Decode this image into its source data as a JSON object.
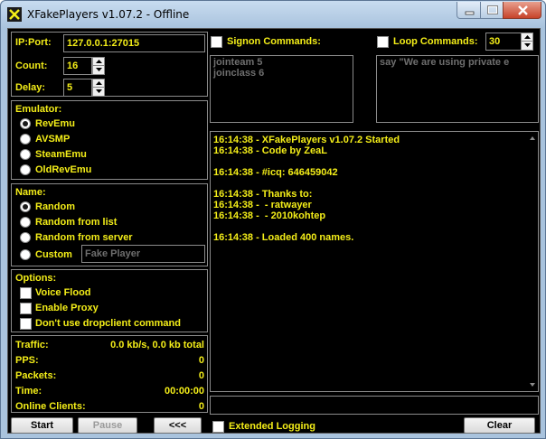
{
  "window": {
    "title": "XFakePlayers v1.07.2 - Offline"
  },
  "connection": {
    "ip_label": "IP:Port:",
    "ip_value": "127.0.0.1:27015",
    "count_label": "Count:",
    "count_value": "16",
    "delay_label": "Delay:",
    "delay_value": "5"
  },
  "emulator": {
    "label": "Emulator:",
    "options": [
      "RevEmu",
      "AVSMP",
      "SteamEmu",
      "OldRevEmu"
    ],
    "selected": "RevEmu"
  },
  "name": {
    "label": "Name:",
    "options": [
      "Random",
      "Random from list",
      "Random from server",
      "Custom"
    ],
    "selected": "Random",
    "custom_value": "Fake Player"
  },
  "options": {
    "label": "Options:",
    "checks": [
      "Voice Flood",
      "Enable Proxy",
      "Don't use dropclient command"
    ]
  },
  "stats": {
    "traffic_label": "Traffic:",
    "traffic_value": "0.0 kb/s, 0.0 kb total",
    "pps_label": "PPS:",
    "pps_value": "0",
    "packets_label": "Packets:",
    "packets_value": "0",
    "time_label": "Time:",
    "time_value": "00:00:00",
    "clients_label": "Online Clients:",
    "clients_value": "0"
  },
  "buttons": {
    "start": "Start",
    "pause": "Pause",
    "collapse": "<<<",
    "clear": "Clear"
  },
  "signon": {
    "label": "Signon Commands:",
    "lines": [
      "jointeam 5",
      "joinclass 6"
    ]
  },
  "loop": {
    "label": "Loop Commands:",
    "interval": "30",
    "text": "say \"We are using private e"
  },
  "log": {
    "lines": [
      "16:14:38 - XFakePlayers v1.07.2 Started",
      "16:14:38 - Code by ZeaL",
      "",
      "16:14:38 - #icq: 646459042",
      "",
      "16:14:38 - Thanks to:",
      "16:14:38 -  - ratwayer",
      "16:14:38 -  - 2010kohtep",
      "",
      "16:14:38 - Loaded 400 names."
    ]
  },
  "command_input": {
    "value": ""
  },
  "extended_logging": {
    "label": "Extended Logging"
  },
  "colors": {
    "text": "#f4ee18",
    "background": "#000000",
    "frame": "#a9c3dd"
  },
  "icons": [
    "app-icon",
    "minimize-icon",
    "maximize-icon",
    "close-icon",
    "scroll-up-icon",
    "scroll-down-icon",
    "spin-up-icon",
    "spin-down-icon"
  ]
}
